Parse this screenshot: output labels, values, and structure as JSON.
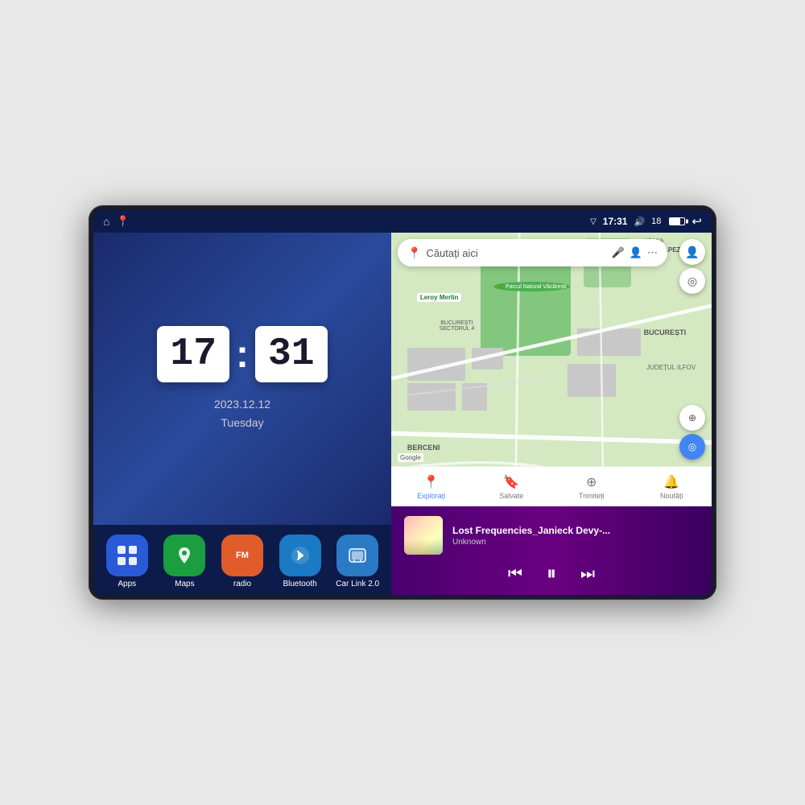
{
  "device": {
    "status_bar": {
      "signal_icon": "▽",
      "time": "17:31",
      "volume_icon": "🔊",
      "battery_level": "18",
      "battery_icon": "🔋",
      "back_icon": "↩"
    },
    "nav_icons": {
      "home": "⌂",
      "maps_pin": "📍"
    }
  },
  "clock_widget": {
    "hours": "17",
    "minutes": "31",
    "date": "2023.12.12",
    "day": "Tuesday"
  },
  "apps": [
    {
      "id": "apps",
      "label": "Apps",
      "icon": "⊞",
      "color": "#2a5bd7"
    },
    {
      "id": "maps",
      "label": "Maps",
      "icon": "📍",
      "color": "#1a9e3f"
    },
    {
      "id": "radio",
      "label": "radio",
      "icon": "FM",
      "color": "#e05c2a"
    },
    {
      "id": "bluetooth",
      "label": "Bluetooth",
      "icon": "⚡",
      "color": "#1a7ac4"
    },
    {
      "id": "carlink",
      "label": "Car Link 2.0",
      "icon": "🔗",
      "color": "#2a7ac4"
    }
  ],
  "map": {
    "search_placeholder": "Căutați aici",
    "nav_items": [
      {
        "id": "explore",
        "label": "Explorați",
        "icon": "📍",
        "active": true
      },
      {
        "id": "saved",
        "label": "Salvate",
        "icon": "🔖",
        "active": false
      },
      {
        "id": "share",
        "label": "Trimiteți",
        "icon": "⊕",
        "active": false
      },
      {
        "id": "news",
        "label": "Noutăți",
        "icon": "🔔",
        "active": false
      }
    ],
    "labels": {
      "trapezului": "TRAPEZULUI",
      "uzana": "UZANA",
      "berceni": "BERCENI",
      "bucuresti": "BUCUREȘTI",
      "ilfov": "JUDEȚUL ILFOV",
      "sector4": "BUCUREȘTI\nSECTORUL 4",
      "leroy": "Leroy Merlin",
      "parcul": "Parcul Natural Văcărești"
    }
  },
  "music_player": {
    "title": "Lost Frequencies_Janieck Devy-...",
    "artist": "Unknown",
    "prev_label": "⏮",
    "play_label": "⏸",
    "next_label": "⏭"
  }
}
